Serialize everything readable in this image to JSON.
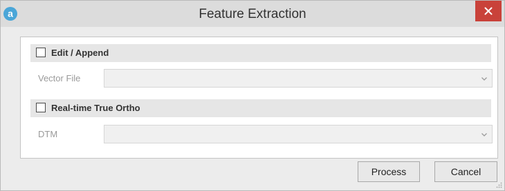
{
  "window": {
    "title": "Feature Extraction",
    "app_icon_letter": "a",
    "close_glyph": "×"
  },
  "sections": {
    "edit_append": {
      "label": "Edit / Append",
      "checked": false
    },
    "vector_file": {
      "label": "Vector File",
      "value": ""
    },
    "realtime_ortho": {
      "label": "Real-time True Ortho",
      "checked": false
    },
    "dtm": {
      "label": "DTM",
      "value": ""
    }
  },
  "buttons": {
    "process": "Process",
    "cancel": "Cancel"
  },
  "icons": {
    "app": "app-logo-icon",
    "close": "close-icon",
    "dropdown": "chevron-down-icon",
    "resize": "resize-grip-icon"
  },
  "colors": {
    "close_button": "#c9423a",
    "app_icon": "#4aa6d8"
  }
}
